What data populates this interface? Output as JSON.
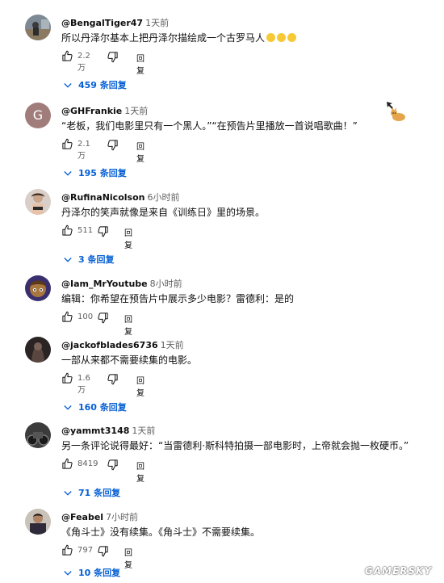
{
  "comments": [
    {
      "author": "@BengalTiger47",
      "time": "1天前",
      "text": "所以丹泽尔基本上把丹泽尔描绘成一个古罗马人",
      "emoji": [
        "rolling-on-floor-laughing",
        "rolling-on-floor-laughing",
        "rolling-on-floor-laughing"
      ],
      "likes": "2.2万",
      "reply_label": "回复",
      "replies_label": "459 条回复"
    },
    {
      "author": "@GHFrankie",
      "time": "1天前",
      "avatar_letter": "G",
      "text": "“老板，我们电影里只有一个黑人。”“在预告片里播放一首说唱歌曲！”",
      "likes": "2.1万",
      "reply_label": "回复",
      "replies_label": "195 条回复"
    },
    {
      "author": "@RufinaNicolson",
      "time": "6小时前",
      "text": "丹泽尔的笑声就像是来自《训练日》里的场景。",
      "likes": "511",
      "reply_label": "回复",
      "replies_label": "3 条回复"
    },
    {
      "author": "@Iam_MrYoutube",
      "time": "8小时前",
      "text": "编辑：你希望在预告片中展示多少电影？雷德利：是的",
      "likes": "100",
      "reply_label": "回复"
    },
    {
      "author": "@jackofblades6736",
      "time": "1天前",
      "text": "一部从来都不需要续集的电影。",
      "likes": "1.6万",
      "reply_label": "回复",
      "replies_label": "160 条回复"
    },
    {
      "author": "@yammt3148",
      "time": "1天前",
      "text": "另一条评论说得最好：“当雷德利·斯科特拍摄一部电影时，上帝就会抛一枚硬币。”",
      "likes": "8419",
      "reply_label": "回复",
      "replies_label": "71 条回复"
    },
    {
      "author": "@Feabel",
      "time": "7小时前",
      "text": "《角斗士》没有续集。《角斗士》不需要续集。",
      "likes": "797",
      "reply_label": "回复",
      "replies_label": "10 条回复"
    }
  ],
  "watermark": "GAMERSKY",
  "colors": {
    "link_blue": "#065fd4",
    "meta_gray": "#606060",
    "avatar_g": "#a07c7a"
  }
}
